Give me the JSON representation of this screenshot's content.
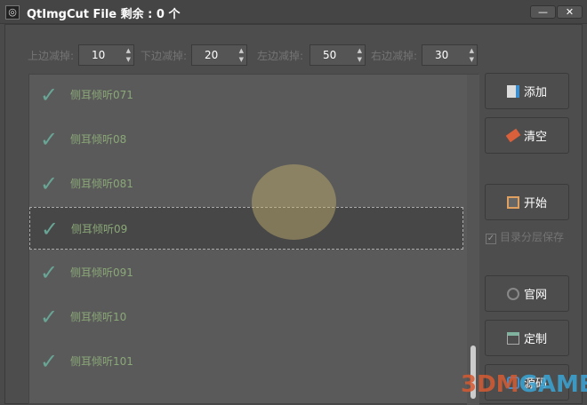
{
  "window": {
    "title": "QtImgCut  File 剩余 : 0 个",
    "minimize": "—",
    "close": "✕"
  },
  "margins": [
    {
      "label": "上边减掉:",
      "value": "10"
    },
    {
      "label": "下边减掉:",
      "value": "20"
    },
    {
      "label": "左边减掉:",
      "value": "50"
    },
    {
      "label": "右边减掉:",
      "value": "30"
    }
  ],
  "files": [
    "侧耳倾听071",
    "侧耳倾听08",
    "侧耳倾听081",
    "侧耳倾听09",
    "侧耳倾听091",
    "侧耳倾听10",
    "侧耳倾听101"
  ],
  "selected_index": 3,
  "buttons": {
    "add": "添加",
    "clear": "清空",
    "start": "开始",
    "website": "官网",
    "custom": "定制",
    "source": "源码"
  },
  "checkbox": {
    "label": "目录分层保存",
    "checked": true
  },
  "watermark": {
    "a": "3DM",
    "b": "GAME"
  }
}
